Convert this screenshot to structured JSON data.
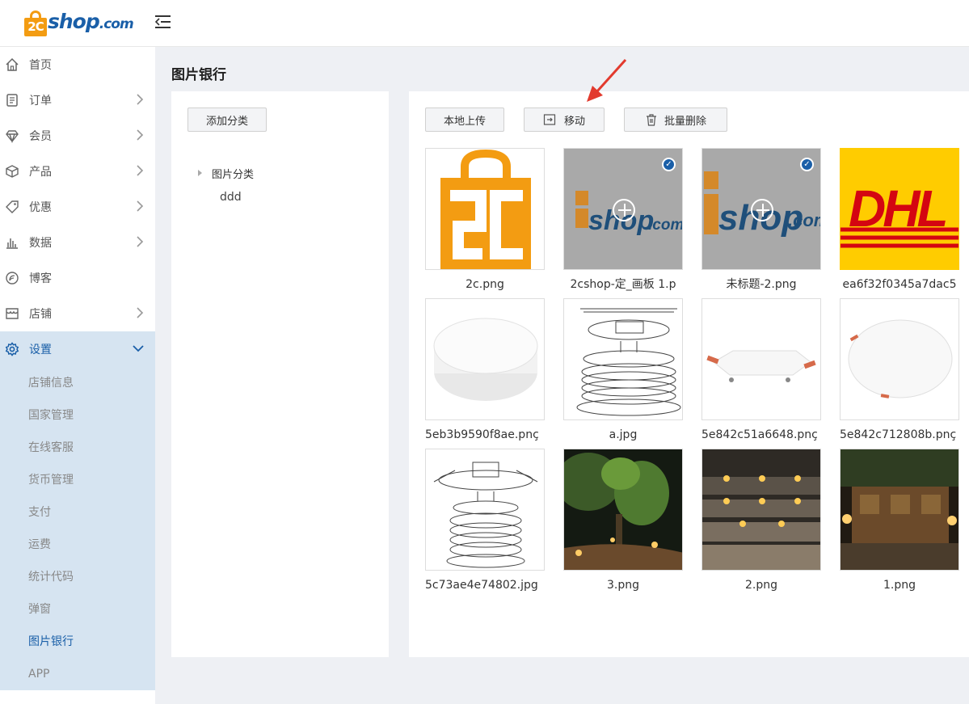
{
  "logo": {
    "mark_text": "2C",
    "text": "shop",
    "suffix": ".com"
  },
  "sidebar": {
    "items": [
      {
        "label": "首页",
        "icon": "home-icon",
        "has_arrow": false
      },
      {
        "label": "订单",
        "icon": "order-icon",
        "has_arrow": true
      },
      {
        "label": "会员",
        "icon": "diamond-icon",
        "has_arrow": true
      },
      {
        "label": "产品",
        "icon": "box-icon",
        "has_arrow": true
      },
      {
        "label": "优惠",
        "icon": "tag-icon",
        "has_arrow": true
      },
      {
        "label": "数据",
        "icon": "bar-chart-icon",
        "has_arrow": true
      },
      {
        "label": "博客",
        "icon": "blog-icon",
        "has_arrow": false
      },
      {
        "label": "店铺",
        "icon": "store-icon",
        "has_arrow": true
      },
      {
        "label": "设置",
        "icon": "gear-icon",
        "has_arrow": true,
        "expanded": true
      }
    ],
    "sub_items": [
      "店铺信息",
      "国家管理",
      "在线客服",
      "货币管理",
      "支付",
      "运费",
      "统计代码",
      "弹窗",
      "图片银行",
      "APP"
    ],
    "current_sub": "图片银行"
  },
  "page": {
    "title": "图片银行"
  },
  "category_panel": {
    "add_button": "添加分类",
    "tree_root": "图片分类",
    "tree_child": "ddd"
  },
  "toolbar": {
    "upload": "本地上传",
    "move": "移动",
    "batch_delete": "批量删除"
  },
  "images": [
    {
      "name": "2c.png",
      "selected": false,
      "art": "logo-2c"
    },
    {
      "name": "2cshop-定_画板 1.p",
      "selected": true,
      "art": "logo-shop"
    },
    {
      "name": "未标题-2.png",
      "selected": true,
      "art": "logo-shop-big"
    },
    {
      "name": "ea6f32f0345a7dac5",
      "selected": false,
      "art": "dhl"
    },
    {
      "name": "5eb3b9590f8ae.pnç",
      "selected": false,
      "art": "round-light"
    },
    {
      "name": "a.jpg",
      "selected": false,
      "art": "exploded"
    },
    {
      "name": "5e842c51a6648.pnç",
      "selected": false,
      "art": "square-panel"
    },
    {
      "name": "5e842c712808b.pnç",
      "selected": false,
      "art": "round-panel"
    },
    {
      "name": "5c73ae4e74802.jpg",
      "selected": false,
      "art": "exploded2"
    },
    {
      "name": "3.png",
      "selected": false,
      "art": "garden"
    },
    {
      "name": "2.png",
      "selected": false,
      "art": "steps"
    },
    {
      "name": "1.png",
      "selected": false,
      "art": "wall"
    }
  ],
  "colors": {
    "brand_blue": "#1a5fa8",
    "brand_orange": "#f39c12",
    "dhl_yellow": "#ffcc00",
    "dhl_red": "#d40511"
  }
}
